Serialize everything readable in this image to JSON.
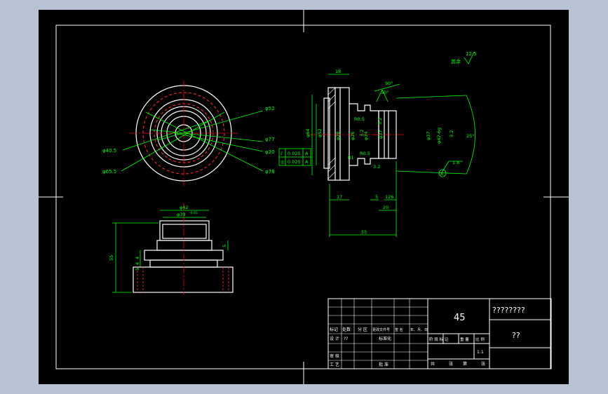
{
  "colors": {
    "background": "#b7c3d3",
    "paper": "#000000",
    "frame": "#ffffff",
    "outline": "#ffffff",
    "dimension": "#00ff00",
    "centerline": "#ff0000",
    "hidden": "#ff3333"
  },
  "front_view": {
    "labels": {
      "d52": "φ52",
      "d77": "φ77",
      "d20": "φ20",
      "d78": "φ78",
      "d40_5": "φ40.5",
      "d65_5": "φ65.5"
    }
  },
  "section_view": {
    "roughness_note": "其余",
    "roughness_value": "12.5",
    "dims": {
      "top_18": "18",
      "angle_90": "90°",
      "angle_30": "30°",
      "d64": "φ64",
      "d52": "φ52",
      "d20": "φ20",
      "d26": "φ26",
      "d34": "φ34",
      "d37": "φ37",
      "d37b": "φ37",
      "d42": "φ42-6g",
      "r05a": "R0.5",
      "r05b": "R0.5",
      "r1": "R1",
      "angle_25": "25°",
      "ra32a": "3.2",
      "ra32b": "3.2",
      "ra32c": "3.2",
      "ra16": "1.6",
      "ra32d": "3.2",
      "bottom_17": "17",
      "bottom_5a": "5",
      "bottom_126": "126",
      "bottom_20": "20",
      "bottom_55": "55",
      "datum": "A"
    },
    "tolerances": [
      {
        "symbol": "⫽",
        "value": "0.025",
        "datum": "A"
      },
      {
        "symbol": "◎",
        "value": "0.025",
        "datum": "A"
      }
    ]
  },
  "side_view": {
    "dims": {
      "d42": "φ42",
      "d39": "φ39",
      "d39_tol": "-0.05",
      "height_55": "55",
      "h5": "5",
      "h4": "4",
      "h4b": "4",
      "h5b": "5"
    }
  },
  "title_block": {
    "material": "45",
    "drawing_name": "????????",
    "company": "??",
    "row_labels": {
      "mark": "标记",
      "count": "处数",
      "zone": "分 区",
      "change_doc": "更改文件号",
      "sign": "签 名",
      "date": "年、月、日",
      "design": "设 计",
      "design_name": "??",
      "standard": "标准化",
      "review": "审 核",
      "process": "工 艺",
      "approve": "批 准"
    },
    "stage_labels": {
      "stage": "阶 段 标 记",
      "weight": "重 量",
      "scale": "比 例",
      "scale_value": "1:1",
      "total": "共",
      "sheets": "张",
      "page": "第",
      "page2": "张"
    }
  }
}
